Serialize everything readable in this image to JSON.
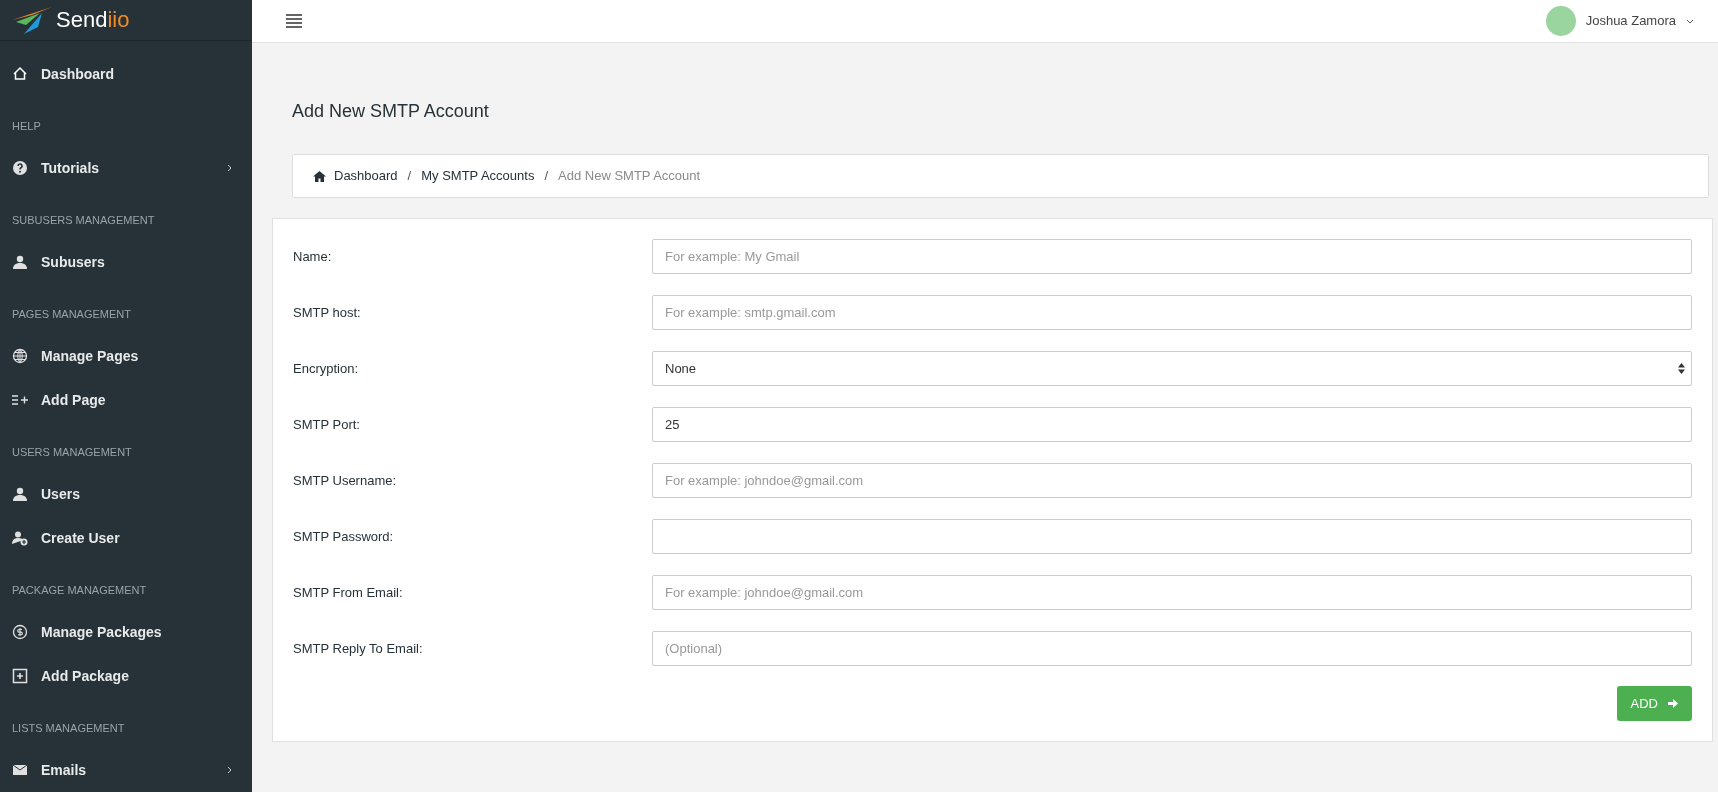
{
  "sidebar": {
    "logo": {
      "main": "Send",
      "accent": "iio"
    },
    "sections": [
      {
        "items": [
          {
            "label": "Dashboard",
            "submenu": false
          }
        ]
      },
      {
        "heading": "HELP",
        "items": [
          {
            "label": "Tutorials",
            "submenu": true
          }
        ]
      },
      {
        "heading": "SUBUSERS MANAGEMENT",
        "items": [
          {
            "label": "Subusers",
            "submenu": false
          }
        ]
      },
      {
        "heading": "PAGES MANAGEMENT",
        "items": [
          {
            "label": "Manage Pages",
            "submenu": false
          },
          {
            "label": "Add Page",
            "submenu": false
          }
        ]
      },
      {
        "heading": "USERS MANAGEMENT",
        "items": [
          {
            "label": "Users",
            "submenu": false
          },
          {
            "label": "Create User",
            "submenu": false
          }
        ]
      },
      {
        "heading": "PACKAGE MANAGEMENT",
        "items": [
          {
            "label": "Manage Packages",
            "submenu": false
          },
          {
            "label": "Add Package",
            "submenu": false
          }
        ]
      },
      {
        "heading": "LISTS MANAGEMENT",
        "items": [
          {
            "label": "Emails",
            "submenu": true
          }
        ]
      }
    ]
  },
  "header": {
    "user_name": "Joshua Zamora"
  },
  "page_title": "Add New SMTP Account",
  "breadcrumb": [
    {
      "label": "Dashboard",
      "current": false
    },
    {
      "separator": "/",
      "label": "My SMTP Accounts",
      "current": false
    },
    {
      "separator": "/",
      "label": "Add New SMTP Account",
      "current": true
    }
  ],
  "form": {
    "fields": [
      {
        "label": "Name:",
        "kind": "text",
        "placeholder": "For example: My Gmail"
      },
      {
        "label": "SMTP host:",
        "kind": "text",
        "placeholder": "For example: smtp.gmail.com"
      },
      {
        "label": "Encryption:",
        "kind": "select",
        "value": "None"
      },
      {
        "label": "SMTP Port:",
        "kind": "text",
        "value": "25"
      },
      {
        "label": "SMTP Username:",
        "kind": "text",
        "placeholder": "For example: johndoe@gmail.com"
      },
      {
        "label": "SMTP Password:",
        "kind": "password"
      },
      {
        "label": "SMTP From Email:",
        "kind": "text",
        "placeholder": "For example: johndoe@gmail.com"
      },
      {
        "label": "SMTP Reply To Email:",
        "kind": "text",
        "placeholder": "(Optional)"
      }
    ],
    "submit": "ADD"
  }
}
